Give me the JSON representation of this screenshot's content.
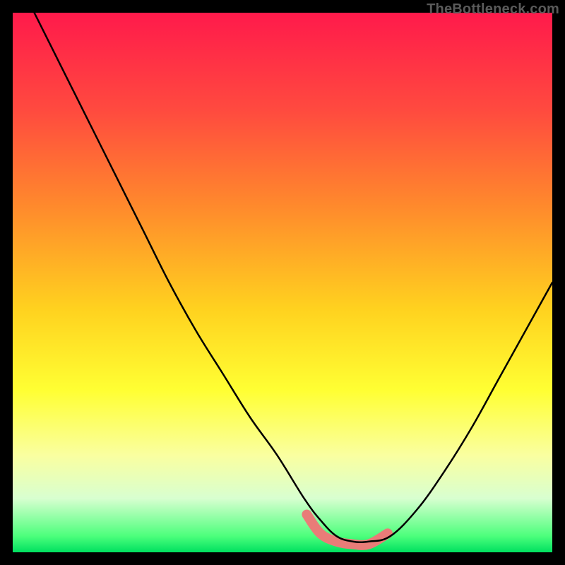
{
  "watermark": "TheBottleneck.com",
  "chart_data": {
    "type": "line",
    "title": "",
    "xlabel": "",
    "ylabel": "",
    "xlim": [
      0,
      100
    ],
    "ylim": [
      0,
      100
    ],
    "series": [
      {
        "name": "bottleneck-curve",
        "stroke": "#000000",
        "x": [
          4,
          9,
          14,
          19,
          24,
          29,
          34,
          39,
          44,
          49,
          54,
          57,
          60,
          63,
          66,
          70,
          75,
          80,
          85,
          90,
          95,
          100
        ],
        "values": [
          100,
          90,
          80,
          70,
          60,
          50,
          41,
          33,
          25,
          18,
          10,
          6,
          3,
          2,
          2,
          3,
          8,
          15,
          23,
          32,
          41,
          50
        ]
      },
      {
        "name": "optimal-band-underline",
        "stroke": "#e97c78",
        "x": [
          54.5,
          57,
          60,
          63,
          66,
          69.5
        ],
        "values": [
          7,
          3.5,
          2,
          1.5,
          1.5,
          3.5
        ]
      }
    ]
  }
}
